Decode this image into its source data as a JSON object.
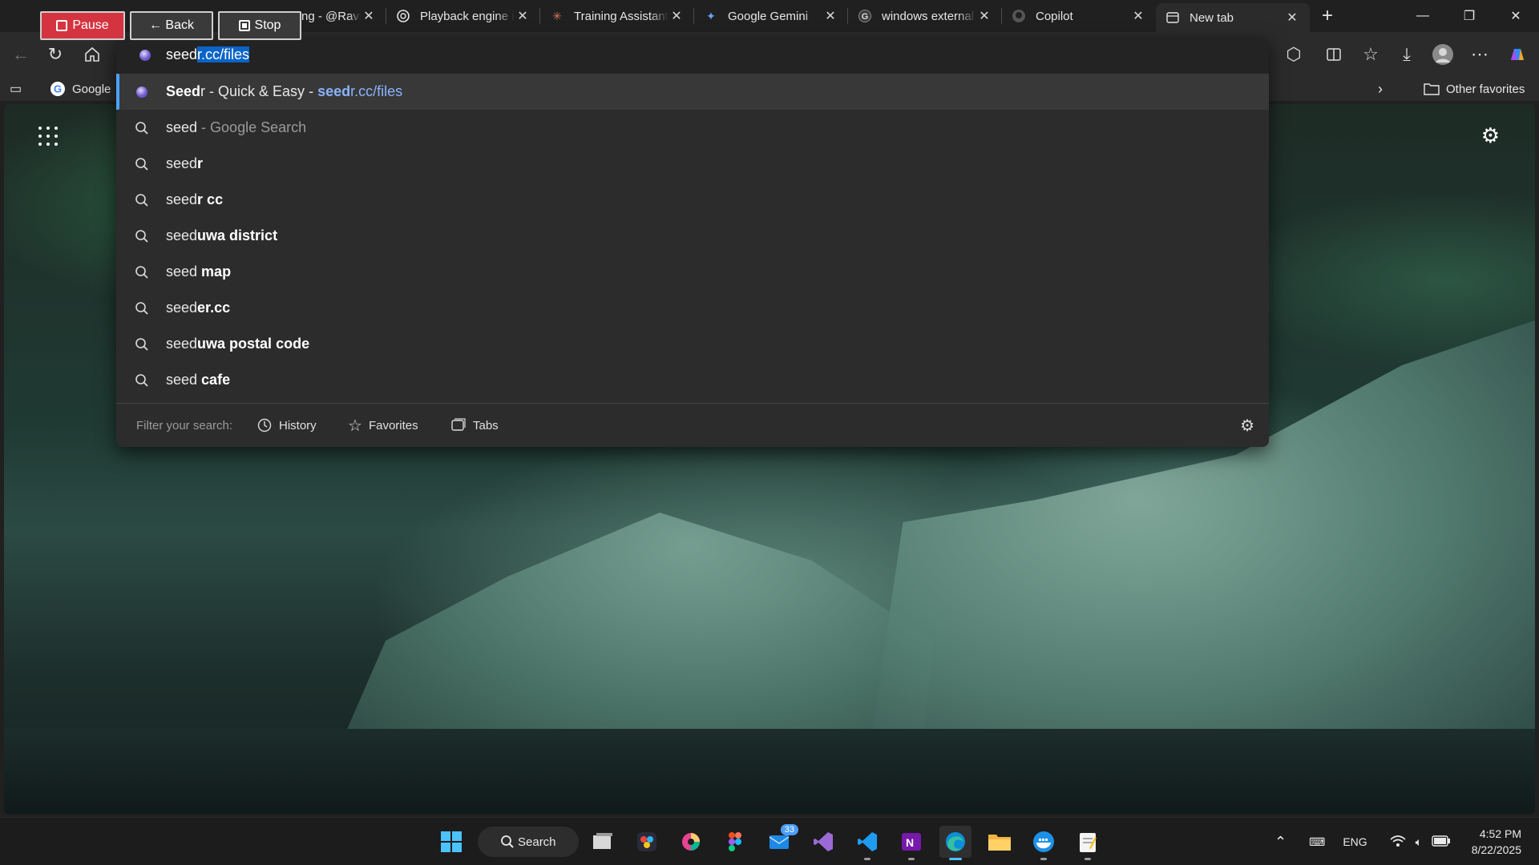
{
  "recorder": {
    "pause_label": "Pause",
    "back_label": "← Back",
    "stop_label": "Stop"
  },
  "tabs": [
    {
      "title": "ng - @Ravin",
      "icon": "x-twitter-icon"
    },
    {
      "title": "Playback engine i",
      "icon": "openai-icon"
    },
    {
      "title": "Training Assistant",
      "icon": "claude-icon"
    },
    {
      "title": "Google Gemini",
      "icon": "gemini-icon"
    },
    {
      "title": "windows external",
      "icon": "google-icon"
    },
    {
      "title": "Copilot",
      "icon": "github-icon"
    },
    {
      "title": "New tab",
      "icon": "newtab-icon",
      "active": true
    }
  ],
  "favorites": {
    "google_label": "Google",
    "other_label": "Other favorites"
  },
  "omnibox": {
    "typed": "seed",
    "autocomplete": "r.cc/files",
    "suggestions": [
      {
        "kind": "site",
        "title_bold": "Seed",
        "title_rest": "r - Quick & Easy",
        "sep": " - ",
        "url_bold": "seed",
        "url_rest": "r.cc/files"
      },
      {
        "kind": "search",
        "plain": "seed",
        "dim": " - Google Search"
      },
      {
        "kind": "search",
        "plain": "seed",
        "bold": "r"
      },
      {
        "kind": "search",
        "plain": "seed",
        "bold": "r cc"
      },
      {
        "kind": "search",
        "plain": "seed",
        "bold": "uwa district"
      },
      {
        "kind": "search",
        "plain": "seed ",
        "bold": "map"
      },
      {
        "kind": "search",
        "plain": "seed",
        "bold": "er.cc"
      },
      {
        "kind": "search",
        "plain": "seed",
        "bold": "uwa postal code"
      },
      {
        "kind": "search",
        "plain": "seed ",
        "bold": "cafe"
      }
    ],
    "filter_label": "Filter your search:",
    "filters": [
      "History",
      "Favorites",
      "Tabs"
    ]
  },
  "taskbar": {
    "search_label": "Search",
    "mail_badge": "33",
    "lang": "ENG",
    "time": "4:52 PM",
    "date": "8/22/2025"
  },
  "colors": {
    "accent": "#4aa3ff",
    "record_red": "#d4343f",
    "selection": "#0a64c8"
  }
}
